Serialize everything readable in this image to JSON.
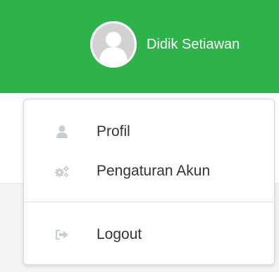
{
  "header": {
    "user_name": "Didik Setiawan",
    "accent_color": "#2eb34a"
  },
  "dropdown": {
    "items": [
      {
        "label": "Profil",
        "icon": "user-icon"
      },
      {
        "label": "Pengaturan Akun",
        "icon": "cogs-icon"
      },
      {
        "label": "Logout",
        "icon": "sign-out-icon"
      }
    ]
  }
}
